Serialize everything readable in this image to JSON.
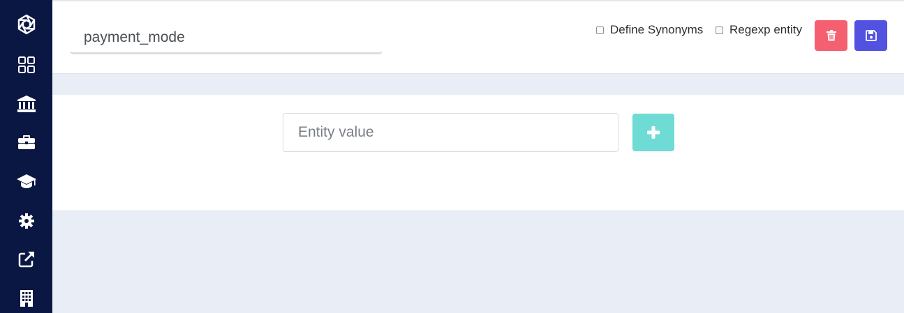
{
  "sidebar": {
    "items": [
      {
        "icon": "brand-logo-icon"
      },
      {
        "icon": "dashboard-grid-icon"
      },
      {
        "icon": "bank-icon"
      },
      {
        "icon": "briefcase-icon"
      },
      {
        "icon": "graduation-cap-icon"
      },
      {
        "icon": "gear-icon"
      },
      {
        "icon": "external-link-icon"
      },
      {
        "icon": "building-icon"
      }
    ]
  },
  "header": {
    "entity_name": "payment_mode",
    "define_synonyms_label": "Define Synonyms",
    "define_synonyms_checked": false,
    "regexp_entity_label": "Regexp entity",
    "regexp_entity_checked": false,
    "delete_icon": "trash-icon",
    "save_icon": "floppy-disk-icon"
  },
  "main": {
    "entity_value_placeholder": "Entity value",
    "add_icon": "plus-icon"
  },
  "colors": {
    "sidebar": "#0b1743",
    "delete": "#f4606f",
    "save": "#5352e0",
    "add": "#6edcd4",
    "background": "#e9edf5"
  }
}
